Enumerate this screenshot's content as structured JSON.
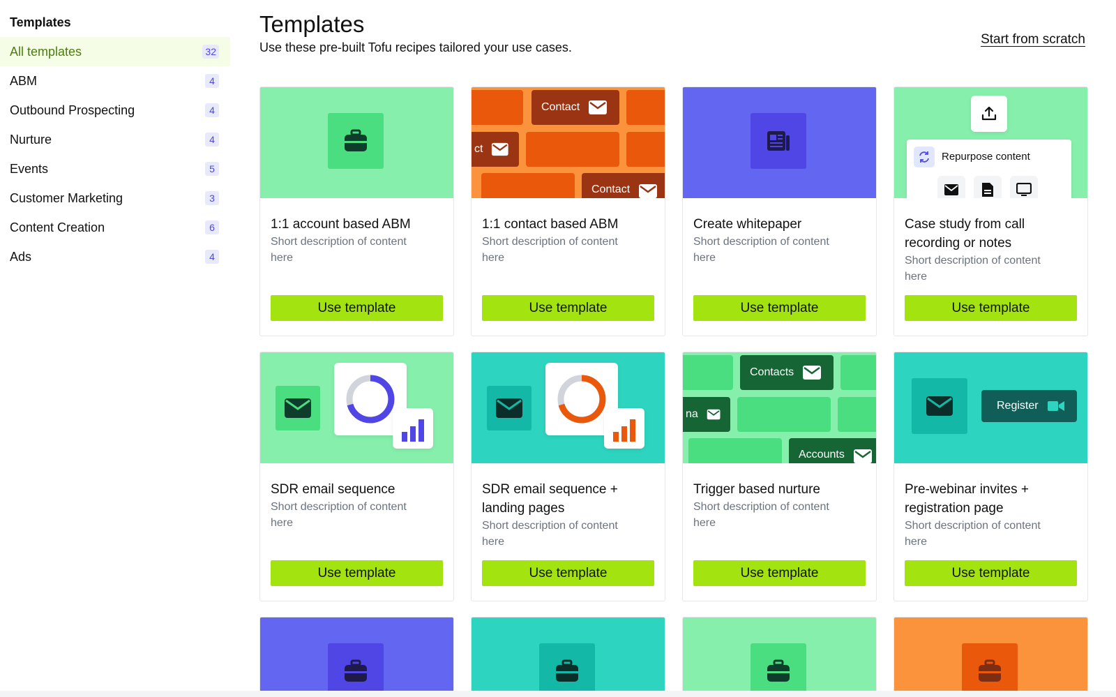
{
  "sidebar": {
    "title": "Templates",
    "items": [
      {
        "label": "All templates",
        "count": "32"
      },
      {
        "label": "ABM",
        "count": "4"
      },
      {
        "label": "Outbound Prospecting",
        "count": "4"
      },
      {
        "label": "Nurture",
        "count": "4"
      },
      {
        "label": "Events",
        "count": "5"
      },
      {
        "label": "Customer Marketing",
        "count": "3"
      },
      {
        "label": "Content Creation",
        "count": "6"
      },
      {
        "label": "Ads",
        "count": "4"
      }
    ]
  },
  "header": {
    "title": "Templates",
    "subtitle": "Use these pre-built Tofu recipes tailored your use cases.",
    "start_link": "Start from scratch"
  },
  "cards": [
    {
      "title": "1:1 account based ABM",
      "desc": "Short description of content here",
      "button": "Use template",
      "icon": "briefcase-icon"
    },
    {
      "title": "1:1 contact based ABM",
      "desc": "Short description of content here",
      "button": "Use template",
      "icon": "envelope-icon",
      "pills": [
        "Contact",
        "ct",
        "Contact"
      ]
    },
    {
      "title": "Create whitepaper",
      "desc": "Short description of content here",
      "button": "Use template",
      "icon": "newspaper-icon"
    },
    {
      "title": "Case study from call recording or notes",
      "desc": "Short description of content here",
      "button": "Use template",
      "icon": "upload-icon",
      "panel_label": "Repurpose content"
    },
    {
      "title": "SDR email sequence",
      "desc": "Short description of content here",
      "button": "Use template",
      "icon": "envelope-icon"
    },
    {
      "title": "SDR email sequence + landing pages",
      "desc": "Short description of content here",
      "button": "Use template",
      "icon": "envelope-icon"
    },
    {
      "title": "Trigger based nurture",
      "desc": "Short description of content here",
      "button": "Use template",
      "icon": "envelope-icon",
      "pills": [
        "Contacts",
        "na",
        "Accounts"
      ]
    },
    {
      "title": "Pre-webinar invites + registration page",
      "desc": "Short description of content here",
      "button": "Use template",
      "icon": "envelope-icon",
      "pills": [
        "Register"
      ]
    }
  ],
  "colors": {
    "accent_lime": "#a3e30f",
    "mint": "#86efac",
    "green": "#4ade80",
    "indigo": "#6366f1",
    "indigo_dark": "#4f46e5",
    "orange": "#ea580c",
    "orange_light": "#fb923c",
    "teal": "#2dd4bf",
    "teal_dark": "#14b8a6"
  }
}
